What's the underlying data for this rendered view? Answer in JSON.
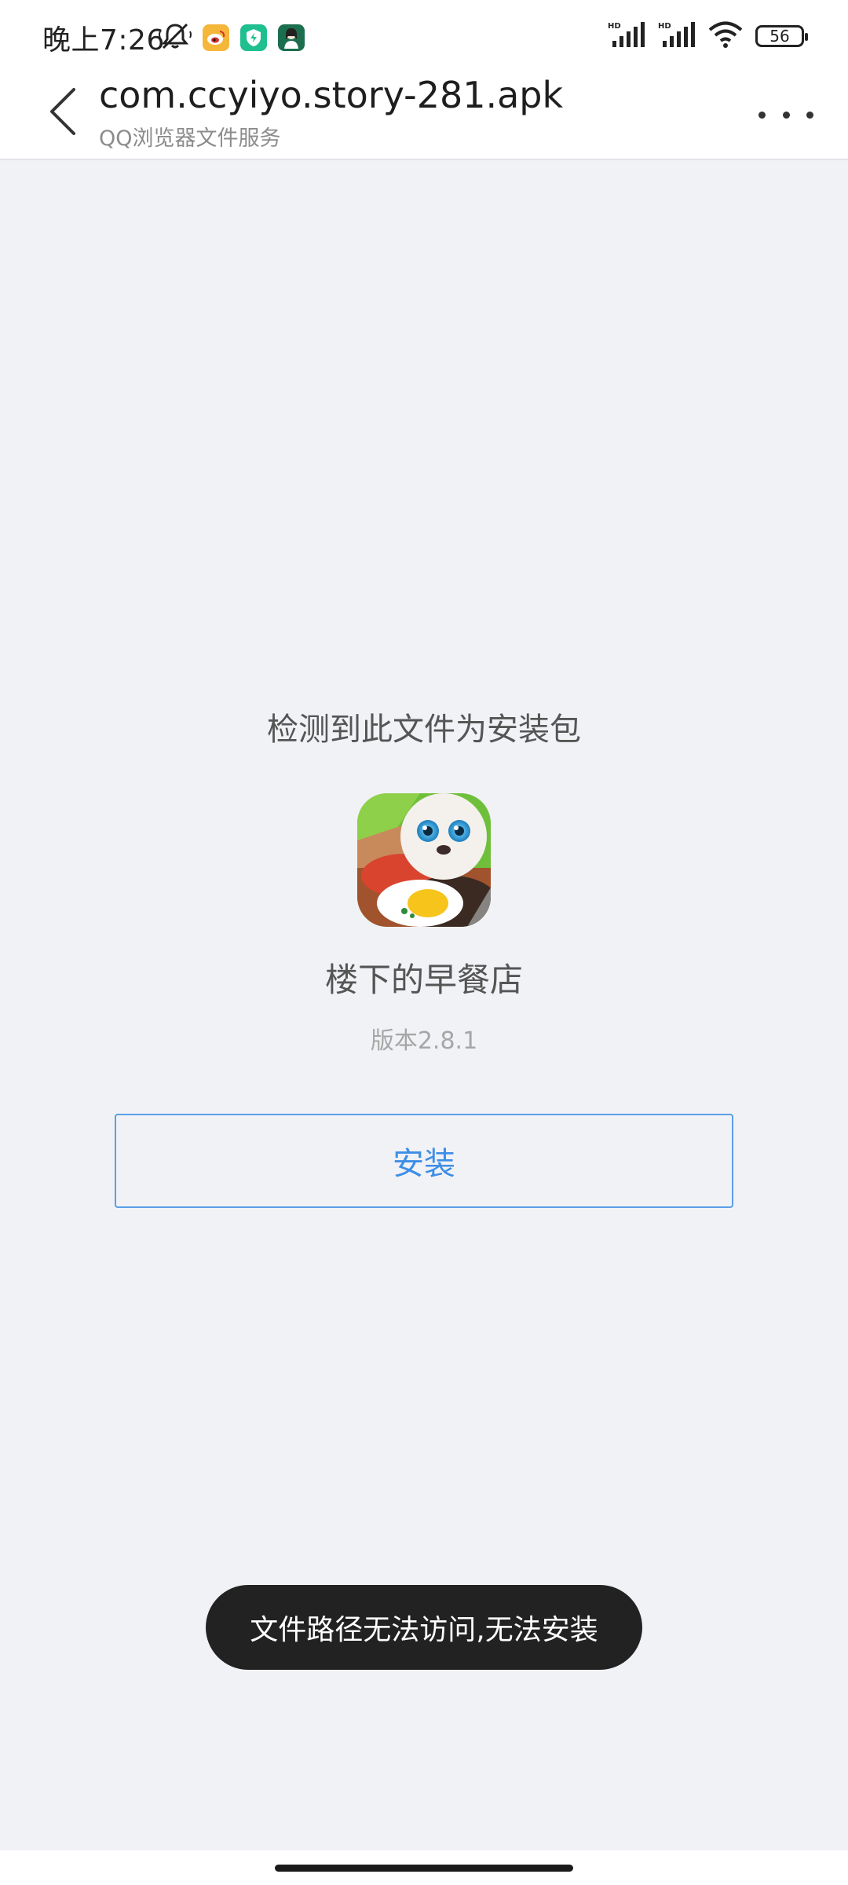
{
  "status_bar": {
    "time": "晚上7:26",
    "left_icons": [
      "muted-bell-icon",
      "weibo-icon",
      "security-shield-icon",
      "avatar-app-icon"
    ],
    "right_icons": [
      "hd-signal-icon",
      "hd-signal-icon",
      "wifi-icon"
    ],
    "hd_label": "HD",
    "battery_level": "56"
  },
  "header": {
    "title": "com.ccyiyo.story-281.apk",
    "subtitle": "QQ浏览器文件服务",
    "back_icon": "chevron-left-icon",
    "more_icon": "more-dots-icon"
  },
  "content": {
    "detect_text": "检测到此文件为安装包",
    "app_name": "楼下的早餐店",
    "version": "版本2.8.1",
    "install_label": "安装"
  },
  "toast": {
    "message": "文件路径无法访问,无法安装"
  },
  "colors": {
    "background": "#f1f2f6",
    "accent": "#3d8ee6",
    "toast_bg": "#222222"
  }
}
